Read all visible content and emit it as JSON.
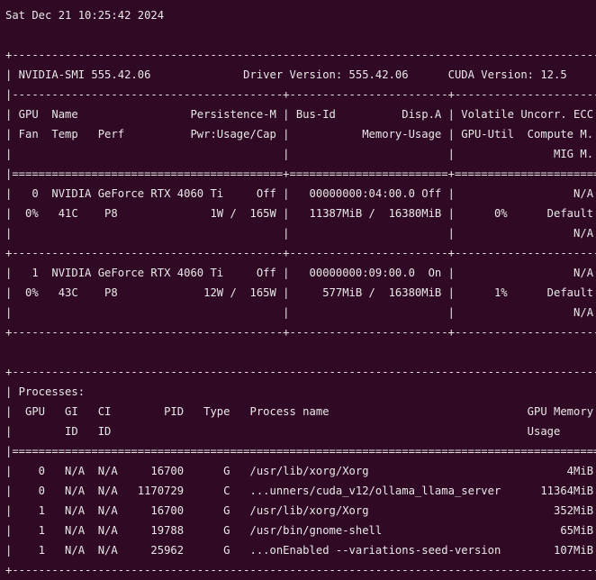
{
  "terminal": {
    "lines": [
      "Sat Dec 21 10:25:42 2024",
      "",
      "+-----------------------------------------------------------------------------------------+",
      "| NVIDIA-SMI 555.42.06              Driver Version: 555.42.06      CUDA Version: 12.5     |",
      "|-----------------------------------------+------------------------+----------------------+",
      "| GPU  Name                 Persistence-M | Bus-Id          Disp.A | Volatile Uncorr. ECC |",
      "| Fan  Temp   Perf          Pwr:Usage/Cap |           Memory-Usage | GPU-Util  Compute M. |",
      "|                                         |                        |               MIG M. |",
      "|=========================================+========================+======================|",
      "|   0  NVIDIA GeForce RTX 4060 Ti     Off |   00000000:04:00.0 Off |                  N/A |",
      "|  0%   41C    P8              1W /  165W |   11387MiB /  16380MiB |      0%      Default |",
      "|                                         |                        |                  N/A |",
      "+-----------------------------------------+------------------------+----------------------+",
      "|   1  NVIDIA GeForce RTX 4060 Ti     Off |   00000000:09:00.0  On |                  N/A |",
      "|  0%   43C    P8             12W /  165W |     577MiB /  16380MiB |      1%      Default |",
      "|                                         |                        |                  N/A |",
      "+-----------------------------------------+------------------------+----------------------+",
      "",
      "+-----------------------------------------------------------------------------------------+",
      "| Processes:                                                                              |",
      "|  GPU   GI   CI        PID   Type   Process name                              GPU Memory |",
      "|        ID   ID                                                               Usage      |",
      "|=========================================================================================|",
      "|    0   N/A  N/A     16700      G   /usr/lib/xorg/Xorg                              4MiB |",
      "|    0   N/A  N/A   1170729      C   ...unners/cuda_v12/ollama_llama_server      11364MiB |",
      "|    1   N/A  N/A     16700      G   /usr/lib/xorg/Xorg                            352MiB |",
      "|    1   N/A  N/A     19788      G   /usr/bin/gnome-shell                           65MiB |",
      "|    1   N/A  N/A     25962      G   ...onEnabled --variations-seed-version        107MiB |",
      "+-----------------------------------------------------------------------------------------+"
    ]
  }
}
